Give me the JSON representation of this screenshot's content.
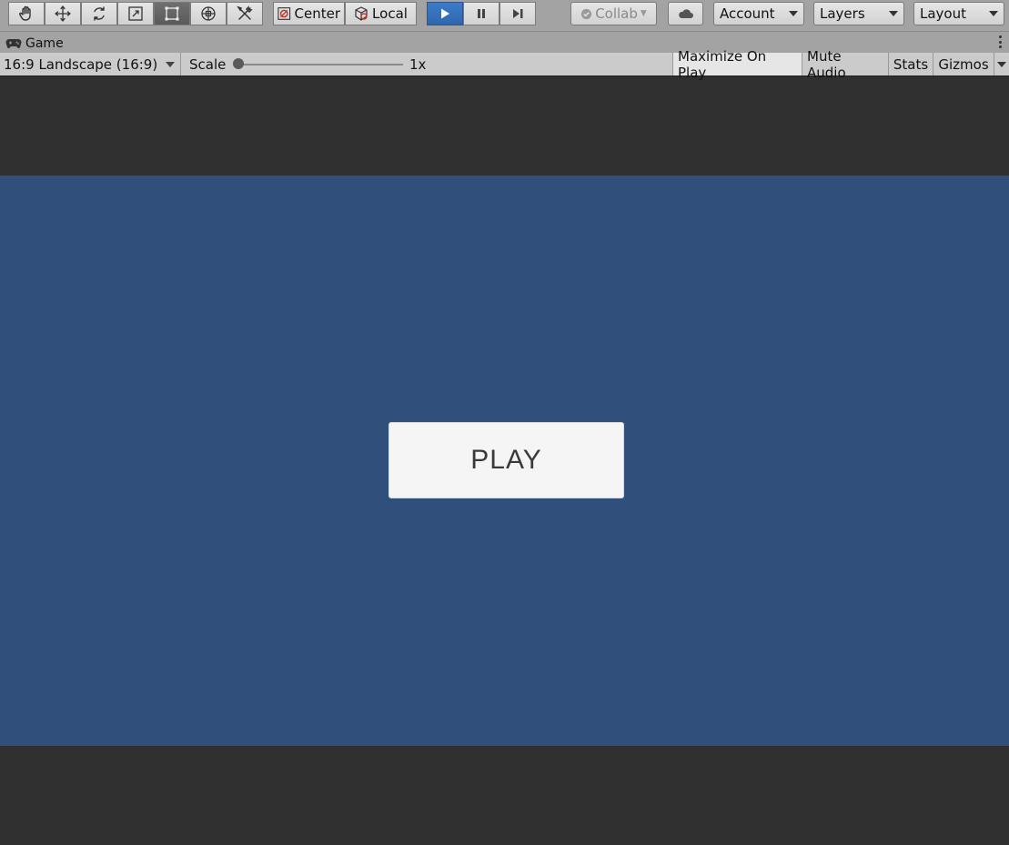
{
  "toolbar": {
    "tools": [
      {
        "name": "hand-tool",
        "active": false
      },
      {
        "name": "move-tool",
        "active": false
      },
      {
        "name": "rotate-tool",
        "active": false
      },
      {
        "name": "scale-tool",
        "active": false
      },
      {
        "name": "rect-tool",
        "active": true
      },
      {
        "name": "transform-tool",
        "active": false
      },
      {
        "name": "custom-tool",
        "active": false
      }
    ],
    "pivot_label": "Center",
    "space_label": "Local",
    "play_state": "playing",
    "collab_label": "Collab",
    "account_label": "Account",
    "layers_label": "Layers",
    "layout_label": "Layout",
    "accent_color": "#3471c4"
  },
  "tab": {
    "title": "Game"
  },
  "game_controls": {
    "aspect_value": "16:9 Landscape (16:9)",
    "scale_label": "Scale",
    "scale_value": "1x",
    "scale_level": 0,
    "maximize_label": "Maximize On Play",
    "mute_label": "Mute Audio",
    "stats_label": "Stats",
    "gizmos_label": "Gizmos"
  },
  "game_view": {
    "background_color": "#304f7a",
    "letterbox_color": "#303030",
    "play_button_label": "PLAY"
  }
}
